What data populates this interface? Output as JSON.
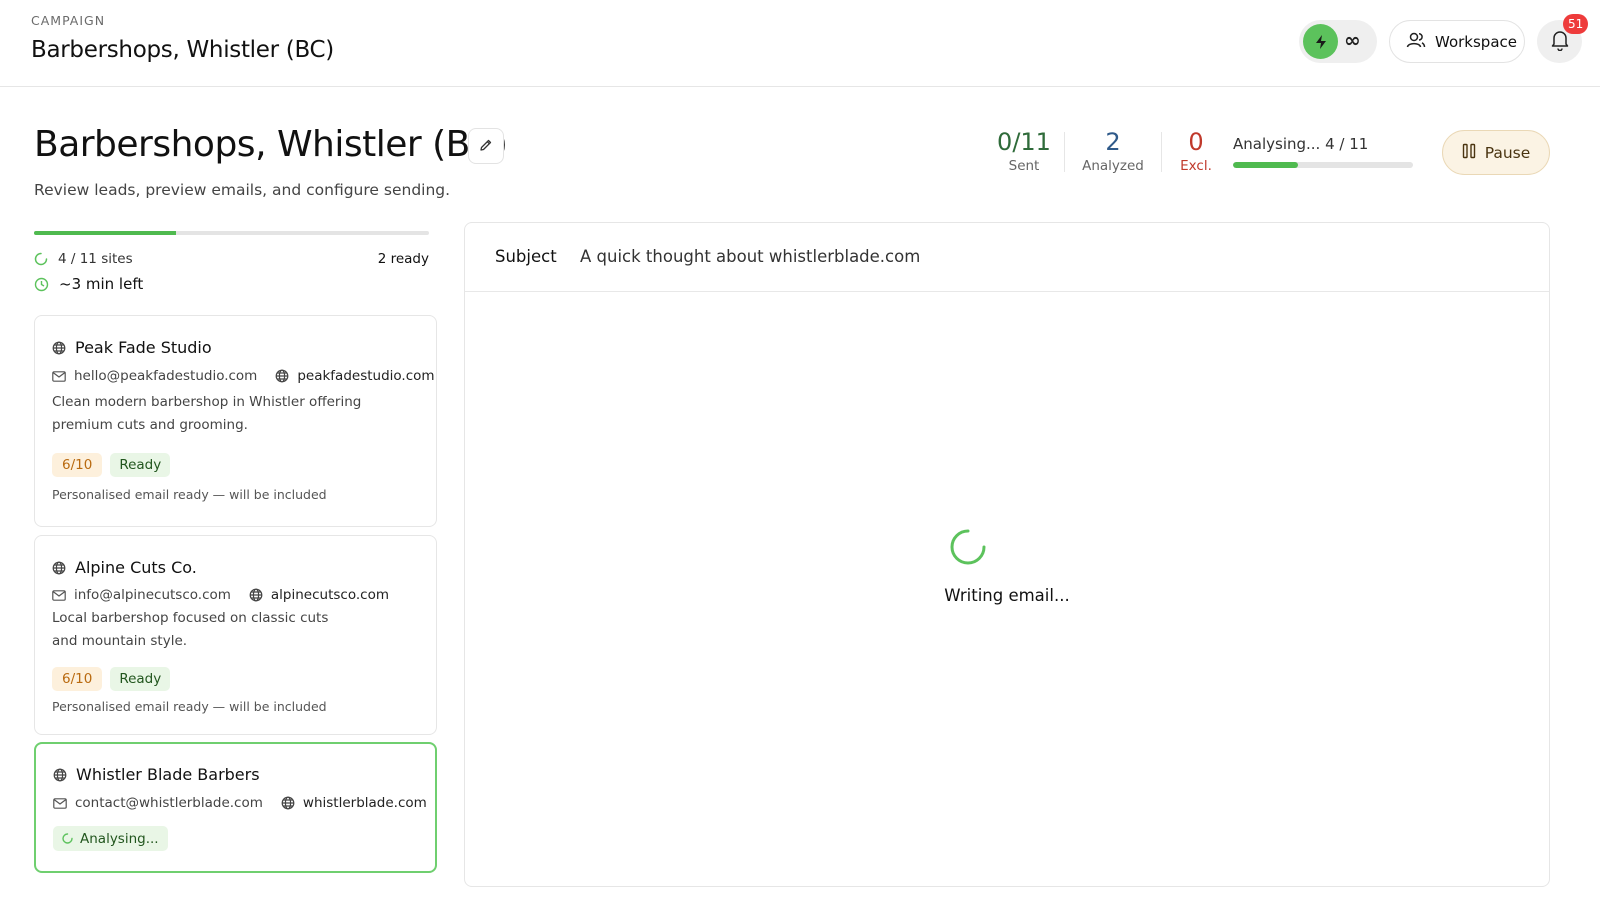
{
  "topbar": {
    "label": "CAMPAIGN",
    "title": "Barbershops, Whistler (BC)",
    "plan_symbol": "∞",
    "workspace_label": "Workspace",
    "notifications_count": "51"
  },
  "header": {
    "title": "Barbershops, Whistler (BC)",
    "subtitle": "Review leads, preview emails, and configure sending.",
    "stats": [
      {
        "value": "0/11",
        "label": "Sent",
        "color": "#2f6b3a"
      },
      {
        "value": "2",
        "label": "Analyzed",
        "color": "#2f5a8a"
      },
      {
        "value": "0",
        "label": "Excl.",
        "color": "#c0392b"
      }
    ],
    "analysing_text": "Analysing... 4 / 11",
    "analysing_progress": 0.36,
    "pause_label": "Pause"
  },
  "progress": {
    "fraction": 0.36,
    "sites_text": "4 / 11 sites",
    "ready_text": "2 ready",
    "time_left": "~3 min left"
  },
  "leads": [
    {
      "name": "Peak Fade Studio",
      "email": "hello@peakfadestudio.com",
      "website": "peakfadestudio.com",
      "description_lines": [
        "Clean modern barbershop in Whistler offering",
        "premium cuts and grooming."
      ],
      "score": "6/10",
      "status": "Ready",
      "note": "Personalised email ready — will be included"
    },
    {
      "name": "Alpine Cuts Co.",
      "email": "info@alpinecutsco.com",
      "website": "alpinecutsco.com",
      "description_lines": [
        "Local barbershop focused on classic cuts",
        "and mountain style."
      ],
      "score": "6/10",
      "status": "Ready",
      "note": "Personalised email ready — will be included"
    },
    {
      "name": "Whistler Blade Barbers",
      "email": "contact@whistlerblade.com",
      "website": "whistlerblade.com",
      "status": "Analysing..."
    }
  ],
  "email_preview": {
    "subject_label": "Subject",
    "subject": "A quick thought about whistlerblade.com",
    "loading_text": "Writing email..."
  },
  "colors": {
    "accent_green": "#4fba4f",
    "score_orange": "#b96a10",
    "pause_bg": "#fbf3e4"
  }
}
